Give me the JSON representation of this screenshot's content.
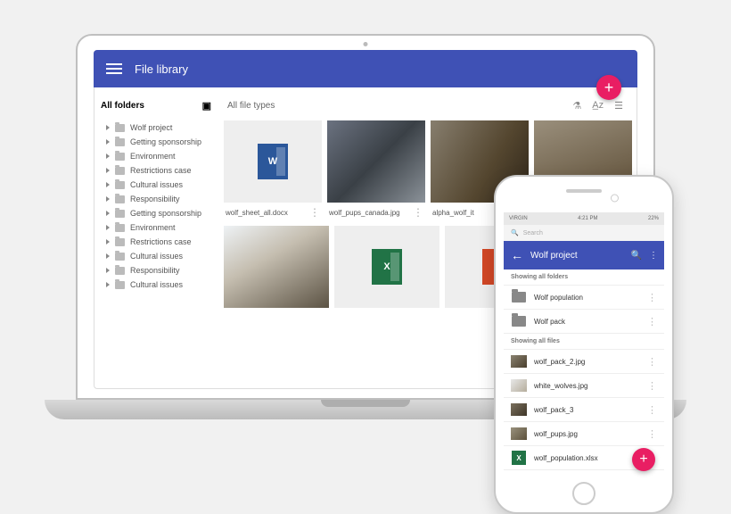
{
  "desktop": {
    "title": "File library",
    "sidebar": {
      "header": "All folders",
      "items": [
        {
          "label": "Wolf project"
        },
        {
          "label": "Getting sponsorship"
        },
        {
          "label": "Environment"
        },
        {
          "label": "Restrictions case"
        },
        {
          "label": "Cultural issues"
        },
        {
          "label": "Responsibility"
        },
        {
          "label": "Getting sponsorship"
        },
        {
          "label": "Environment"
        },
        {
          "label": "Restrictions case"
        },
        {
          "label": "Cultural issues"
        },
        {
          "label": "Responsibility"
        },
        {
          "label": "Cultural issues"
        }
      ]
    },
    "filter_label": "All file types",
    "files_row1": [
      {
        "name": "wolf_sheet_all.docx",
        "kind": "word"
      },
      {
        "name": "wolf_pups_canada.jpg",
        "kind": "img1"
      },
      {
        "name": "alpha_wolf_it",
        "kind": "img2"
      },
      {
        "name": "",
        "kind": "img3"
      }
    ],
    "files_row2": [
      {
        "kind": "img4"
      },
      {
        "kind": "excel"
      },
      {
        "kind": "pp"
      }
    ]
  },
  "phone": {
    "status": {
      "carrier": "VIRGIN",
      "time": "4:21 PM",
      "battery": "22%"
    },
    "search_placeholder": "Search",
    "title": "Wolf project",
    "section_folders": "Showing all folders",
    "folders": [
      {
        "label": "Wolf population"
      },
      {
        "label": "Wolf pack"
      }
    ],
    "section_files": "Showing all files",
    "files": [
      {
        "label": "wolf_pack_2.jpg",
        "kind": "mi1"
      },
      {
        "label": "white_wolves.jpg",
        "kind": "mi2"
      },
      {
        "label": "wolf_pack_3",
        "kind": "mi3"
      },
      {
        "label": "wolf_pups.jpg",
        "kind": "mi4"
      },
      {
        "label": "wolf_population.xlsx",
        "kind": "xl"
      }
    ]
  }
}
